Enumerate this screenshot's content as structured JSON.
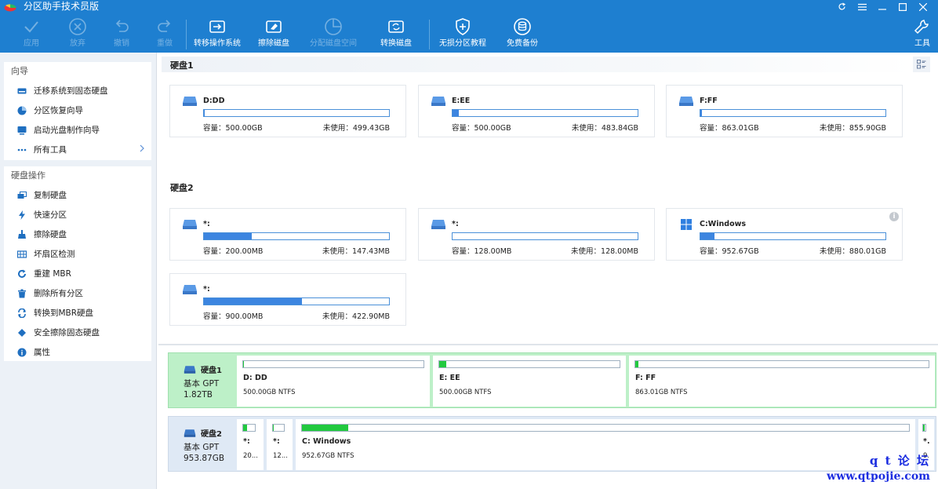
{
  "app": {
    "title": "分区助手技术员版"
  },
  "toolbar": {
    "apply": "应用",
    "discard": "放弃",
    "undo": "撤销",
    "redo": "重做",
    "migrate_os": "转移操作系统",
    "wipe_disk": "擦除磁盘",
    "allocate_space": "分配磁盘空间",
    "convert_disk": "转换磁盘",
    "lossless_tutorial": "无损分区教程",
    "free_backup": "免费备份",
    "tools": "工具"
  },
  "sidebar": {
    "wizard": {
      "title": "向导",
      "items": [
        {
          "label": "迁移系统到固态硬盘",
          "icon": "migrate-disk-icon"
        },
        {
          "label": "分区恢复向导",
          "icon": "recovery-pie-icon"
        },
        {
          "label": "启动光盘制作向导",
          "icon": "boot-cd-icon"
        },
        {
          "label": "所有工具",
          "icon": "more-dots-icon"
        }
      ]
    },
    "disk_ops": {
      "title": "硬盘操作",
      "items": [
        {
          "label": "复制硬盘",
          "icon": "copy-disk-icon"
        },
        {
          "label": "快速分区",
          "icon": "lightning-icon"
        },
        {
          "label": "擦除硬盘",
          "icon": "wipe-icon"
        },
        {
          "label": "坏扇区检测",
          "icon": "sector-check-icon"
        },
        {
          "label": "重建 MBR",
          "icon": "rebuild-icon"
        },
        {
          "label": "删除所有分区",
          "icon": "trash-icon"
        },
        {
          "label": "转换到MBR硬盘",
          "icon": "convert-icon"
        },
        {
          "label": "安全擦除固态硬盘",
          "icon": "eraser-icon"
        },
        {
          "label": "属性",
          "icon": "info-icon"
        }
      ]
    }
  },
  "disk_cards": {
    "disk1": {
      "title": "硬盘1",
      "partitions": [
        {
          "name": "D:DD",
          "cap_label": "容量：500.00GB",
          "free_label": "未使用：499.43GB",
          "used_fraction": 0.001
        },
        {
          "name": "E:EE",
          "cap_label": "容量：500.00GB",
          "free_label": "未使用：483.84GB",
          "used_fraction": 0.032
        },
        {
          "name": "F:FF",
          "cap_label": "容量：863.01GB",
          "free_label": "未使用：855.90GB",
          "used_fraction": 0.008
        }
      ]
    },
    "disk2": {
      "title": "硬盘2",
      "partitions": [
        {
          "name": "*:",
          "cap_label": "容量：200.00MB",
          "free_label": "未使用：147.43MB",
          "used_fraction": 0.26
        },
        {
          "name": "*:",
          "cap_label": "容量：128.00MB",
          "free_label": "未使用：128.00MB",
          "used_fraction": 0
        },
        {
          "name": "C:Windows",
          "cap_label": "容量：952.67GB",
          "free_label": "未使用：880.01GB",
          "used_fraction": 0.076
        },
        {
          "name": "*:",
          "cap_label": "容量：900.00MB",
          "free_label": "未使用：422.90MB",
          "used_fraction": 0.53
        }
      ]
    }
  },
  "disk_map": {
    "disk1": {
      "name": "硬盘1",
      "type": "基本 GPT",
      "size": "1.82TB",
      "partitions": [
        {
          "name": "D: DD",
          "info": "500.00GB NTFS",
          "used_fraction": 0.002
        },
        {
          "name": "E: EE",
          "info": "500.00GB NTFS",
          "used_fraction": 0.04
        },
        {
          "name": "F: FF",
          "info": "863.01GB NTFS",
          "used_fraction": 0.012
        }
      ]
    },
    "disk2": {
      "name": "硬盘2",
      "type": "基本 GPT",
      "size": "953.87GB",
      "partitions": [
        {
          "name": "*:",
          "info": "20...",
          "used_fraction": 0.3
        },
        {
          "name": "*:",
          "info": "12...",
          "used_fraction": 0.03
        },
        {
          "name": "C: Windows",
          "info": "952.67GB NTFS",
          "used_fraction": 0.076
        },
        {
          "name": "*.",
          "info": "9.",
          "used_fraction": 0.5
        }
      ]
    }
  },
  "watermark": {
    "line1": "q t 论 坛",
    "line2": "www.qtpojie.com"
  },
  "colors": {
    "titlebar": "#1e7fd0",
    "used_bar": "#3c85e0",
    "map_used": "#22c93f",
    "selected_disk_bg": "#bdf0c8"
  }
}
